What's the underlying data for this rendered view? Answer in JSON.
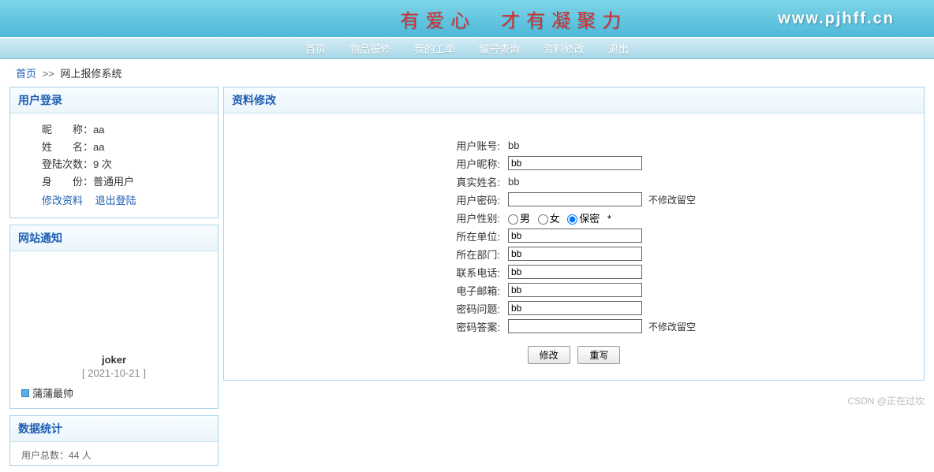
{
  "banner": {
    "tagline": "有爱心　才有凝聚力",
    "url": "www.pjhff.cn"
  },
  "nav": {
    "items": [
      "首页",
      "物品报修",
      "我的工单",
      "编号查询",
      "资料修改",
      "退出"
    ]
  },
  "breadcrumb": {
    "home": "首页",
    "sep": ">>",
    "current": "网上报修系统"
  },
  "sidebar": {
    "login": {
      "title": "用户登录",
      "nickname_label": "昵　　称：",
      "nickname_value": "aa",
      "name_label": "姓　　名：",
      "name_value": "aa",
      "count_label": "登陆次数：",
      "count_value": "9 次",
      "role_label": "身　　份：",
      "role_value": "普通用户",
      "edit_link": "修改资料",
      "logout_link": "退出登陆"
    },
    "notice": {
      "title": "网站通知",
      "author": "joker",
      "date": "[ 2021-10-21 ]",
      "item1": "蒲蒲最帅"
    },
    "stats": {
      "title": "数据统计",
      "users_label": "用户总数：",
      "users_value": "44 人"
    }
  },
  "main": {
    "title": "资料修改",
    "form": {
      "account_label": "用户账号:",
      "account_value": "bb",
      "nickname_label": "用户昵称:",
      "nickname_value": "bb",
      "realname_label": "真实姓名:",
      "realname_value": "bb",
      "password_label": "用户密码:",
      "password_value": "",
      "password_hint": "不修改留空",
      "gender_label": "用户性别:",
      "gender_male": "男",
      "gender_female": "女",
      "gender_secret": "保密",
      "gender_star": "*",
      "org_label": "所在单位:",
      "org_value": "bb",
      "dept_label": "所在部门:",
      "dept_value": "bb",
      "phone_label": "联系电话:",
      "phone_value": "bb",
      "email_label": "电子邮箱:",
      "email_value": "bb",
      "question_label": "密码问题:",
      "question_value": "bb",
      "answer_label": "密码答案:",
      "answer_value": "",
      "answer_hint": "不修改留空",
      "submit": "修改",
      "reset": "重写"
    }
  },
  "watermark": "CSDN @正在过坎"
}
